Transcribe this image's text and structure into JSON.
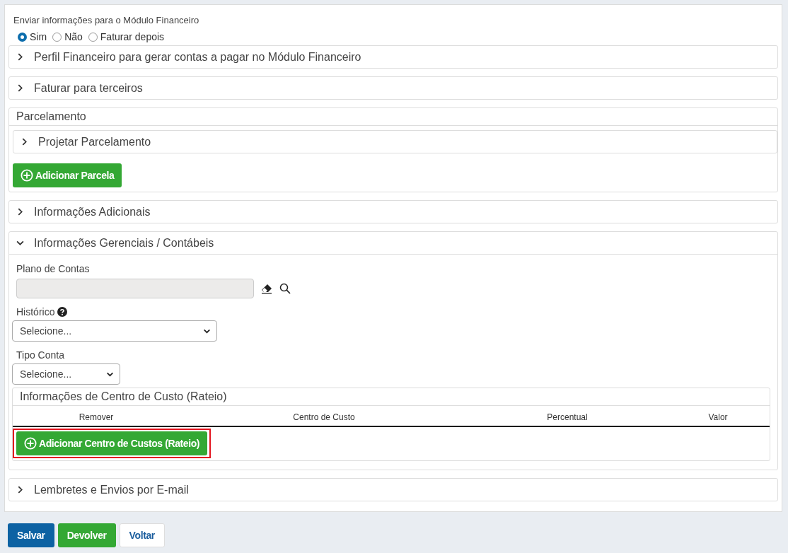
{
  "send_to_financial": {
    "label": "Enviar informações para o Módulo Financeiro",
    "options": [
      {
        "label": "Sim",
        "selected": true
      },
      {
        "label": "Não",
        "selected": false
      },
      {
        "label": "Faturar depois",
        "selected": false
      }
    ]
  },
  "sections": [
    {
      "kind": "collapsible",
      "title": "Perfil Financeiro para gerar contas a pagar no Módulo Financeiro",
      "expanded": false
    },
    {
      "kind": "collapsible",
      "title": "Faturar para terceiros",
      "expanded": false
    },
    {
      "kind": "installments",
      "title": "Parcelamento",
      "subsection": {
        "title": "Projetar Parcelamento",
        "expanded": false
      },
      "button": "Adicionar Parcela"
    },
    {
      "kind": "collapsible",
      "title": "Informações Adicionais",
      "expanded": false
    },
    {
      "kind": "management",
      "title": "Informações Gerenciais / Contábeis",
      "expanded": true,
      "plano_de_contas": {
        "label": "Plano de Contas",
        "disabled": true
      },
      "historico": {
        "label": "Histórico",
        "value": "Selecione..."
      },
      "tipo_conta": {
        "label": "Tipo Conta",
        "value": "Selecione..."
      },
      "cost_center": {
        "title": "Informações de Centro de Custo (Rateio)",
        "columns": [
          "Remover",
          "Centro de Custo",
          "Percentual",
          "Valor"
        ],
        "button": {
          "label": "Adicionar Centro de Custos (Rateio)",
          "highlighted": true
        }
      }
    },
    {
      "kind": "collapsible",
      "title": "Lembretes e Envios por E-mail",
      "expanded": false
    }
  ],
  "buttons": [
    {
      "label": "Salvar",
      "kind": "primary"
    },
    {
      "label": "Devolver",
      "kind": "success"
    },
    {
      "label": "Voltar",
      "kind": "light"
    }
  ]
}
